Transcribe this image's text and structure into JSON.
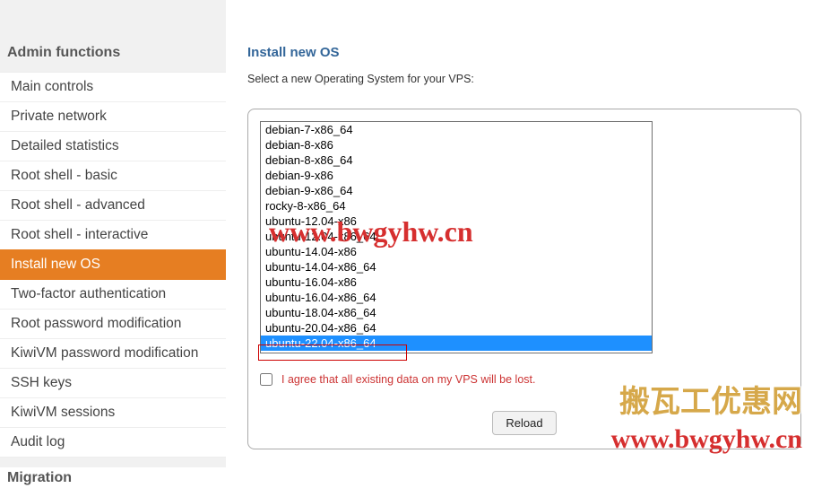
{
  "sidebar": {
    "header1": "Admin functions",
    "header2": "Migration",
    "items": [
      {
        "label": "Main controls",
        "active": false
      },
      {
        "label": "Private network",
        "active": false
      },
      {
        "label": "Detailed statistics",
        "active": false
      },
      {
        "label": "Root shell - basic",
        "active": false
      },
      {
        "label": "Root shell - advanced",
        "active": false
      },
      {
        "label": "Root shell - interactive",
        "active": false
      },
      {
        "label": "Install new OS",
        "active": true
      },
      {
        "label": "Two-factor authentication",
        "active": false
      },
      {
        "label": "Root password modification",
        "active": false
      },
      {
        "label": "KiwiVM password modification",
        "active": false
      },
      {
        "label": "SSH keys",
        "active": false
      },
      {
        "label": "KiwiVM sessions",
        "active": false
      },
      {
        "label": "Audit log",
        "active": false
      }
    ]
  },
  "main": {
    "title": "Install new OS",
    "subtitle": "Select a new Operating System for your VPS:",
    "os_list": [
      "debian-7-x86_64",
      "debian-8-x86",
      "debian-8-x86_64",
      "debian-9-x86",
      "debian-9-x86_64",
      "rocky-8-x86_64",
      "ubuntu-12.04-x86",
      "ubuntu-12.04-x86_64",
      "ubuntu-14.04-x86",
      "ubuntu-14.04-x86_64",
      "ubuntu-16.04-x86",
      "ubuntu-16.04-x86_64",
      "ubuntu-18.04-x86_64",
      "ubuntu-20.04-x86_64",
      "ubuntu-22.04-x86_64"
    ],
    "selected_os": "ubuntu-22.04-x86_64",
    "agree_label": "I agree that all existing data on my VPS will be lost.",
    "agree_checked": false,
    "reload_label": "Reload"
  },
  "watermarks": {
    "w1": "www.bwgyhw.cn",
    "cn": "搬瓦工优惠网",
    "w2": "www.bwgyhw.cn"
  }
}
